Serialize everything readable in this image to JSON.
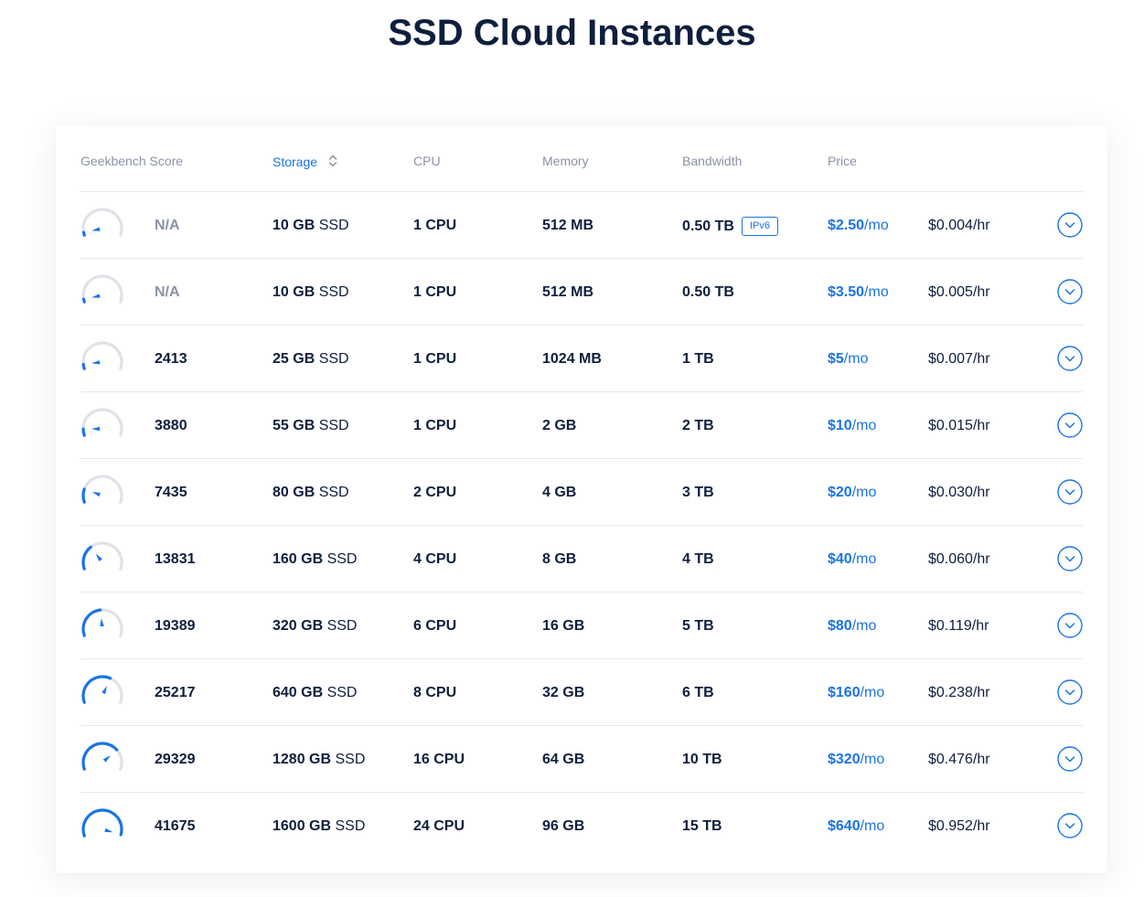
{
  "title": "SSD Cloud Instances",
  "colors": {
    "accent": "#1a73e8",
    "gauge_track": "#dfe2e7",
    "text": "#0e1e3d",
    "muted": "#8a93a3"
  },
  "columns": {
    "geekbench": "Geekbench Score",
    "storage": "Storage",
    "cpu": "CPU",
    "memory": "Memory",
    "bandwidth": "Bandwidth",
    "price": "Price"
  },
  "rows": [
    {
      "gauge": 0.04,
      "score": "N/A",
      "storage_num": "10 GB",
      "storage_unit": " SSD",
      "cpu": "1 CPU",
      "memory": "512 MB",
      "bandwidth": "0.50 TB",
      "badge": "IPv6",
      "price_num": "$2.50",
      "price_unit": "/mo",
      "hourly": "$0.004/hr"
    },
    {
      "gauge": 0.04,
      "score": "N/A",
      "storage_num": "10 GB",
      "storage_unit": " SSD",
      "cpu": "1 CPU",
      "memory": "512 MB",
      "bandwidth": "0.50 TB",
      "badge": "",
      "price_num": "$3.50",
      "price_unit": "/mo",
      "hourly": "$0.005/hr"
    },
    {
      "gauge": 0.06,
      "score": "2413",
      "storage_num": "25 GB",
      "storage_unit": " SSD",
      "cpu": "1 CPU",
      "memory": "1024 MB",
      "bandwidth": "1 TB",
      "badge": "",
      "price_num": "$5",
      "price_unit": "/mo",
      "hourly": "$0.007/hr"
    },
    {
      "gauge": 0.09,
      "score": "3880",
      "storage_num": "55 GB",
      "storage_unit": " SSD",
      "cpu": "1 CPU",
      "memory": "2 GB",
      "bandwidth": "2 TB",
      "badge": "",
      "price_num": "$10",
      "price_unit": "/mo",
      "hourly": "$0.015/hr"
    },
    {
      "gauge": 0.18,
      "score": "7435",
      "storage_num": "80 GB",
      "storage_unit": " SSD",
      "cpu": "2 CPU",
      "memory": "4 GB",
      "bandwidth": "3 TB",
      "badge": "",
      "price_num": "$20",
      "price_unit": "/mo",
      "hourly": "$0.030/hr"
    },
    {
      "gauge": 0.33,
      "score": "13831",
      "storage_num": "160 GB",
      "storage_unit": " SSD",
      "cpu": "4 CPU",
      "memory": "8 GB",
      "bandwidth": "4 TB",
      "badge": "",
      "price_num": "$40",
      "price_unit": "/mo",
      "hourly": "$0.060/hr"
    },
    {
      "gauge": 0.47,
      "score": "19389",
      "storage_num": "320 GB",
      "storage_unit": " SSD",
      "cpu": "6 CPU",
      "memory": "16 GB",
      "bandwidth": "5 TB",
      "badge": "",
      "price_num": "$80",
      "price_unit": "/mo",
      "hourly": "$0.119/hr"
    },
    {
      "gauge": 0.61,
      "score": "25217",
      "storage_num": "640 GB",
      "storage_unit": " SSD",
      "cpu": "8 CPU",
      "memory": "32 GB",
      "bandwidth": "6 TB",
      "badge": "",
      "price_num": "$160",
      "price_unit": "/mo",
      "hourly": "$0.238/hr"
    },
    {
      "gauge": 0.72,
      "score": "29329",
      "storage_num": "1280 GB",
      "storage_unit": " SSD",
      "cpu": "16 CPU",
      "memory": "64 GB",
      "bandwidth": "10 TB",
      "badge": "",
      "price_num": "$320",
      "price_unit": "/mo",
      "hourly": "$0.476/hr"
    },
    {
      "gauge": 0.98,
      "score": "41675",
      "storage_num": "1600 GB",
      "storage_unit": " SSD",
      "cpu": "24 CPU",
      "memory": "96 GB",
      "bandwidth": "15 TB",
      "badge": "",
      "price_num": "$640",
      "price_unit": "/mo",
      "hourly": "$0.952/hr"
    }
  ],
  "icons": {
    "sort": "sort-updown-icon",
    "expand": "chevron-down-circle-icon",
    "gauge": "speedometer-icon"
  }
}
